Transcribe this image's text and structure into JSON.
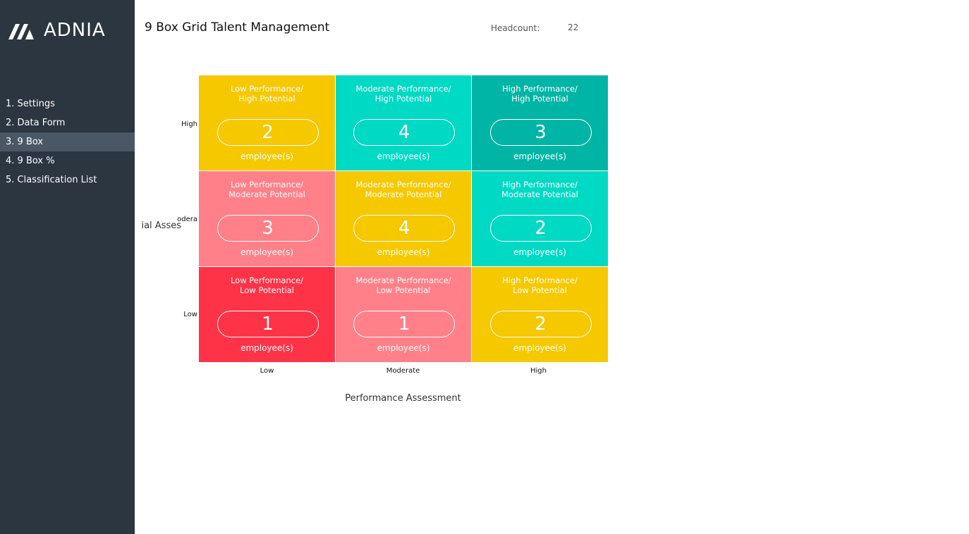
{
  "app": {
    "logo_text": "ADNIA"
  },
  "sidebar": {
    "items": [
      {
        "label": "1. Settings",
        "active": false
      },
      {
        "label": "2. Data Form",
        "active": false
      },
      {
        "label": "3. 9 Box",
        "active": true
      },
      {
        "label": "4. 9 Box %",
        "active": false
      },
      {
        "label": "5. Classification List",
        "active": false
      }
    ]
  },
  "header": {
    "title": "9 Box Grid Talent Management",
    "headcount_label": "Headcount:",
    "headcount_value": "22"
  },
  "grid": {
    "unit_label": "employee(s)",
    "cells": [
      {
        "line1": "Low Performance/",
        "line2": "High Potential",
        "count": "2",
        "color": "#f5c800"
      },
      {
        "line1": "Moderate Performance/",
        "line2": "High Potential",
        "count": "4",
        "color": "#00d9c4"
      },
      {
        "line1": "High Performance/",
        "line2": "High Potential",
        "count": "3",
        "color": "#00b5a5"
      },
      {
        "line1": "Low Performance/",
        "line2": "Moderate Potential",
        "count": "3",
        "color": "#ff8088"
      },
      {
        "line1": "Moderate Performance/",
        "line2": "Moderate Potential",
        "count": "4",
        "color": "#f5c800"
      },
      {
        "line1": "High Performance/",
        "line2": "Moderate Potential",
        "count": "2",
        "color": "#00d9c4"
      },
      {
        "line1": "Low Performance/",
        "line2": "Low Potential",
        "count": "1",
        "color": "#ff3348"
      },
      {
        "line1": "Moderate Performance/",
        "line2": "Low Potential",
        "count": "1",
        "color": "#ff8088"
      },
      {
        "line1": "High Performance/",
        "line2": "Low Potential",
        "count": "2",
        "color": "#f5c800"
      }
    ]
  },
  "axes": {
    "y_label": "tial Asses",
    "y_ticks": [
      "High",
      "odera",
      "Low"
    ],
    "x_label": "Performance Assessment",
    "x_ticks": [
      "Low",
      "Moderate",
      "High"
    ]
  }
}
